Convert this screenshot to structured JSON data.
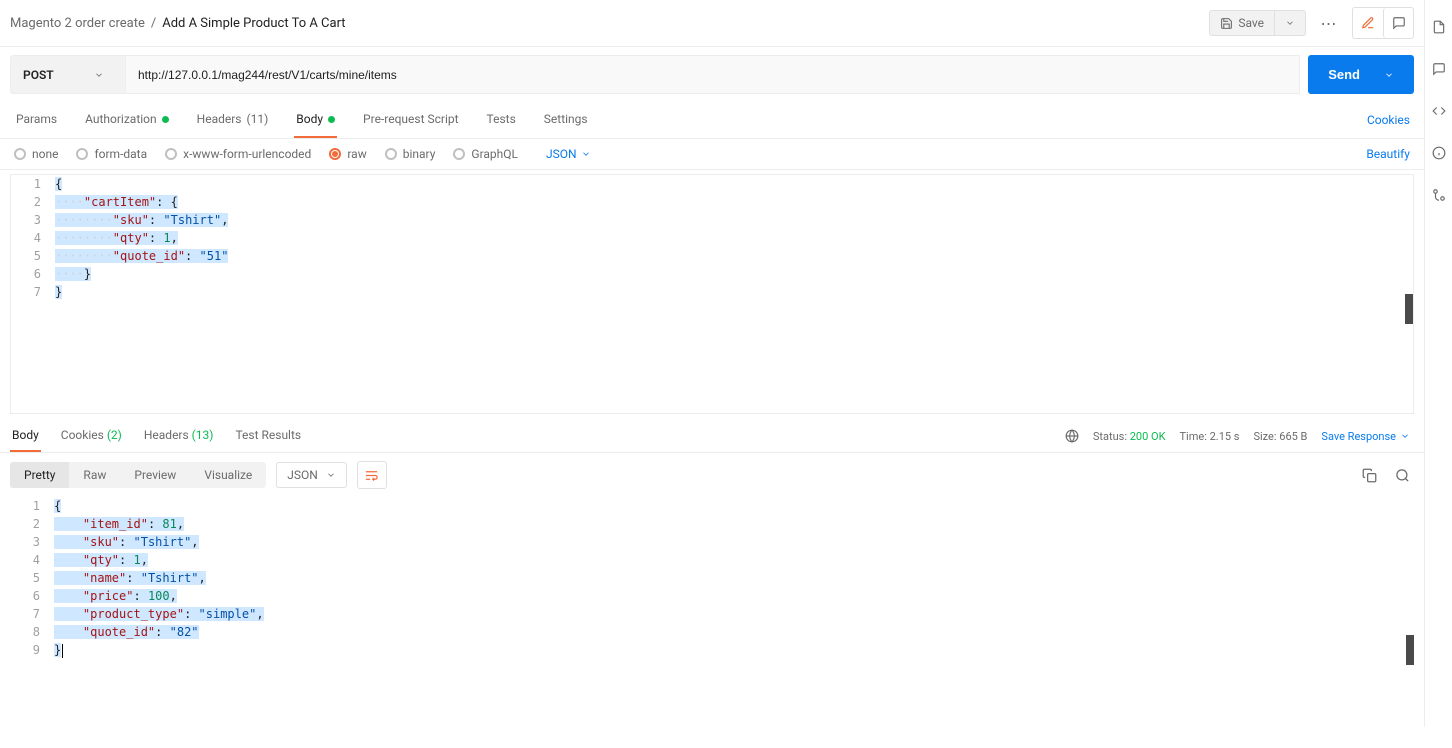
{
  "breadcrumb": {
    "parent": "Magento 2 order create",
    "sep": "/",
    "current": "Add A Simple Product To A Cart"
  },
  "top": {
    "save": "Save",
    "more": "⋯"
  },
  "request": {
    "method": "POST",
    "url": "http://127.0.0.1/mag244/rest/V1/carts/mine/items",
    "send": "Send"
  },
  "tabs": {
    "params": "Params",
    "authorization": "Authorization",
    "headers": "Headers",
    "headers_count": "(11)",
    "body": "Body",
    "prerequest": "Pre-request Script",
    "tests": "Tests",
    "settings": "Settings",
    "cookies": "Cookies"
  },
  "body_types": {
    "none": "none",
    "formdata": "form-data",
    "urlencoded": "x-www-form-urlencoded",
    "raw": "raw",
    "binary": "binary",
    "graphql": "GraphQL",
    "format": "JSON",
    "beautify": "Beautify"
  },
  "req_body": [
    [
      {
        "t": "brace",
        "v": "{"
      }
    ],
    [
      {
        "t": "ws",
        "v": "····"
      },
      {
        "t": "key",
        "v": "\"cartItem\""
      },
      {
        "t": "colon",
        "v": ":"
      },
      {
        "t": "sp",
        "v": " "
      },
      {
        "t": "brace",
        "v": "{"
      }
    ],
    [
      {
        "t": "ws",
        "v": "········"
      },
      {
        "t": "key",
        "v": "\"sku\""
      },
      {
        "t": "colon",
        "v": ":"
      },
      {
        "t": "sp",
        "v": " "
      },
      {
        "t": "str",
        "v": "\"Tshirt\""
      },
      {
        "t": "punc",
        "v": ","
      }
    ],
    [
      {
        "t": "ws",
        "v": "········"
      },
      {
        "t": "key",
        "v": "\"qty\""
      },
      {
        "t": "colon",
        "v": ":"
      },
      {
        "t": "sp",
        "v": " "
      },
      {
        "t": "num",
        "v": "1"
      },
      {
        "t": "punc",
        "v": ","
      }
    ],
    [
      {
        "t": "ws",
        "v": "········"
      },
      {
        "t": "key",
        "v": "\"quote_id\""
      },
      {
        "t": "colon",
        "v": ":"
      },
      {
        "t": "sp",
        "v": " "
      },
      {
        "t": "str",
        "v": "\"51\""
      }
    ],
    [
      {
        "t": "ws",
        "v": "····"
      },
      {
        "t": "brace",
        "v": "}"
      }
    ],
    [
      {
        "t": "brace",
        "v": "}"
      }
    ]
  ],
  "resp_tabs": {
    "body": "Body",
    "cookies": "Cookies",
    "cookies_count": "(2)",
    "headers": "Headers",
    "headers_count": "(13)",
    "tests": "Test Results"
  },
  "resp_meta": {
    "status_label": "Status:",
    "status_value": "200 OK",
    "time_label": "Time:",
    "time_value": "2.15 s",
    "size_label": "Size:",
    "size_value": "665 B",
    "save": "Save Response"
  },
  "resp_toolbar": {
    "pretty": "Pretty",
    "raw": "Raw",
    "preview": "Preview",
    "visualize": "Visualize",
    "format": "JSON"
  },
  "resp_body": [
    [
      {
        "t": "brace",
        "v": "{"
      }
    ],
    [
      {
        "t": "ws",
        "v": "    "
      },
      {
        "t": "key",
        "v": "\"item_id\""
      },
      {
        "t": "colon",
        "v": ":"
      },
      {
        "t": "sp",
        "v": " "
      },
      {
        "t": "num",
        "v": "81"
      },
      {
        "t": "punc",
        "v": ","
      }
    ],
    [
      {
        "t": "ws",
        "v": "    "
      },
      {
        "t": "key",
        "v": "\"sku\""
      },
      {
        "t": "colon",
        "v": ":"
      },
      {
        "t": "sp",
        "v": " "
      },
      {
        "t": "str",
        "v": "\"Tshirt\""
      },
      {
        "t": "punc",
        "v": ","
      }
    ],
    [
      {
        "t": "ws",
        "v": "    "
      },
      {
        "t": "key",
        "v": "\"qty\""
      },
      {
        "t": "colon",
        "v": ":"
      },
      {
        "t": "sp",
        "v": " "
      },
      {
        "t": "num",
        "v": "1"
      },
      {
        "t": "punc",
        "v": ","
      }
    ],
    [
      {
        "t": "ws",
        "v": "    "
      },
      {
        "t": "key",
        "v": "\"name\""
      },
      {
        "t": "colon",
        "v": ":"
      },
      {
        "t": "sp",
        "v": " "
      },
      {
        "t": "str",
        "v": "\"Tshirt\""
      },
      {
        "t": "punc",
        "v": ","
      }
    ],
    [
      {
        "t": "ws",
        "v": "    "
      },
      {
        "t": "key",
        "v": "\"price\""
      },
      {
        "t": "colon",
        "v": ":"
      },
      {
        "t": "sp",
        "v": " "
      },
      {
        "t": "num",
        "v": "100"
      },
      {
        "t": "punc",
        "v": ","
      }
    ],
    [
      {
        "t": "ws",
        "v": "    "
      },
      {
        "t": "key",
        "v": "\"product_type\""
      },
      {
        "t": "colon",
        "v": ":"
      },
      {
        "t": "sp",
        "v": " "
      },
      {
        "t": "str",
        "v": "\"simple\""
      },
      {
        "t": "punc",
        "v": ","
      }
    ],
    [
      {
        "t": "ws",
        "v": "    "
      },
      {
        "t": "key",
        "v": "\"quote_id\""
      },
      {
        "t": "colon",
        "v": ":"
      },
      {
        "t": "sp",
        "v": " "
      },
      {
        "t": "str",
        "v": "\"82\""
      }
    ],
    [
      {
        "t": "brace",
        "v": "}"
      }
    ]
  ]
}
